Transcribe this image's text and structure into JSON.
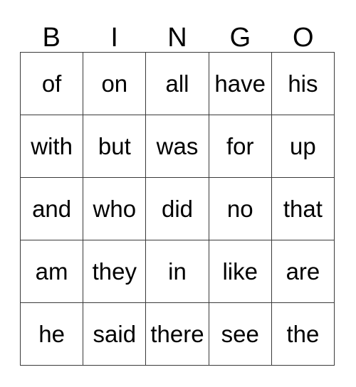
{
  "card": {
    "title": "BINGO",
    "column_headers": [
      "B",
      "I",
      "N",
      "G",
      "O"
    ],
    "rows": [
      [
        "of",
        "on",
        "all",
        "have",
        "his"
      ],
      [
        "with",
        "but",
        "was",
        "for",
        "up"
      ],
      [
        "and",
        "who",
        "did",
        "no",
        "that"
      ],
      [
        "am",
        "they",
        "in",
        "like",
        "are"
      ],
      [
        "he",
        "said",
        "there",
        "see",
        "the"
      ]
    ],
    "colors": {
      "background": "#ffffff",
      "text": "#000000",
      "grid_line": "#3a3a3a"
    }
  }
}
